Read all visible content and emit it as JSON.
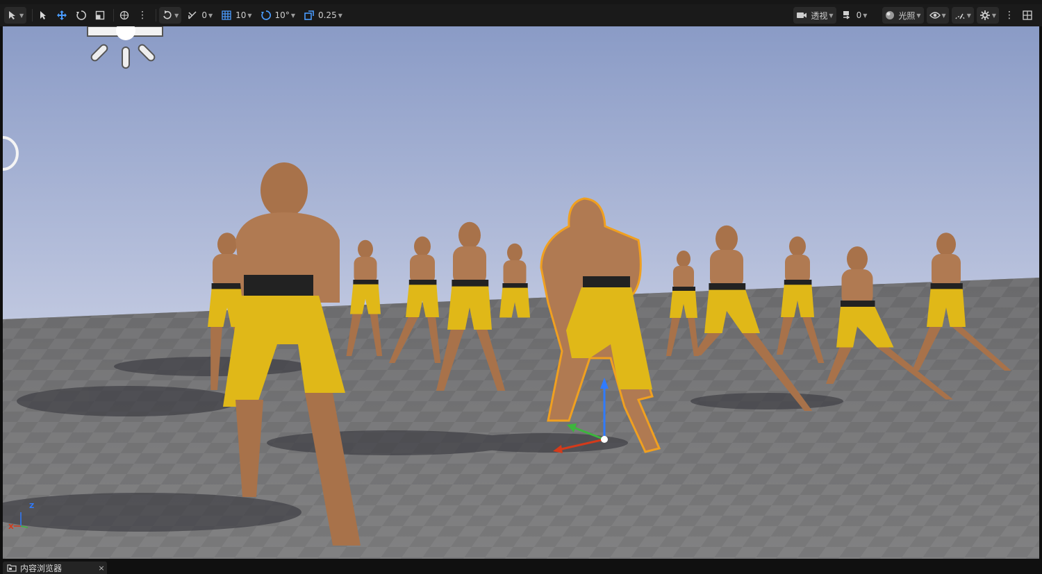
{
  "toolbar": {
    "left": [
      {
        "name": "select-mode-icon"
      },
      {
        "name": "select-arrow-icon"
      },
      {
        "name": "translate-icon"
      },
      {
        "name": "rotate-icon"
      },
      {
        "name": "scale-icon"
      },
      {
        "name": "world-space-icon"
      },
      {
        "name": "more-options-icon"
      },
      {
        "name": "surface-snap-icon"
      }
    ],
    "snap_angle_value": "0",
    "grid_snap_value": "10",
    "rotation_snap_value": "10°",
    "scale_snap_value": "0.25",
    "view_mode_label": "透视",
    "camera_speed_value": "0",
    "lighting_label": "光照"
  },
  "bottom": {
    "tab_label": "内容浏览器",
    "tab_close": "×"
  },
  "viewport": {
    "axis_z": "Z",
    "axis_x": "X",
    "sky_color": "#8fa0c8",
    "floor_color": "#6e6e6e",
    "selection_outline_color": "#f0a020",
    "shorts_color": "#e0b818"
  }
}
